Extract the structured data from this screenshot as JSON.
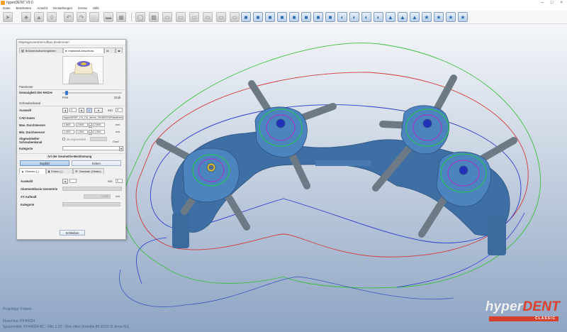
{
  "window": {
    "title": "hyperDENT V9.0"
  },
  "menu": [
    "Datei",
    "Bearbeiten",
    "Ansicht",
    "Einstellungen",
    "Extras",
    "Hilfe"
  ],
  "panel": {
    "title": "Objektgeometrie/Aufbau bestimmen",
    "tabs": [
      "Brückenzwischenglieder",
      "Implantat-Anschluss",
      "Id"
    ],
    "params_header": "Parameter",
    "mesh_accuracy_label": "Genauigkeit des Netzes",
    "slider_min": "Fein",
    "slider_max": "Grob",
    "slider_value": 0.05,
    "screw_header": "Schraubenkanal",
    "selection_label": "Auswahl",
    "selection_count": "4",
    "selection_of": "von",
    "selection_total": "4",
    "cad_label": "CAD-Daten",
    "cad_value": "hyperDENT_C4_CA_direct_20180223/Fräsdirect",
    "max_dia_label": "Max. Durchmesser",
    "max_dia_values": [
      "2.600",
      "2.600",
      "2.600"
    ],
    "min_dia_label": "Min. Durchmesser",
    "min_dia_values": [
      "1.300",
      "1.300",
      "1.300"
    ],
    "unit_mm": "mm",
    "angled_label_1": "Abgewinkelter",
    "angled_label_2": "Schraubenkanal",
    "angled_check": "ist angewinkelt",
    "angle_unit": "Grad",
    "category_label": "Kategorie",
    "geometry_header": "Art der Geometrie-Bestimmung",
    "explicit_label": "Explizit",
    "edges_label": "Ecken",
    "subtabs": [
      "Ebenen (-)",
      "Ecken (-)",
      "Gewinde (Hinten)"
    ],
    "sub_selection_label": "Auswahl",
    "sub_selection_of": "von",
    "sub_selection_total": "0",
    "sub_geometry_label": "Abutmentbasis Geometrie",
    "sub_height_label": "XY-Aufmaß",
    "sub_height_value": "0.000",
    "sub_category_label": "Kategorie",
    "close_label": "Schließen"
  },
  "status": {
    "project": "Projekttyp: Fräsen",
    "machine": "Maschine: PFH4024",
    "clamp": "Spannmittel: PFH4024-BC - FAL 1.22 - Disc offen (Fräsfile 89-ZrO2-11 6mm-N1)"
  },
  "logo": {
    "brand_a": "hyper",
    "brand_b": "DENT",
    "sub": "CLASSIC"
  },
  "toolbar": {
    "icons": [
      "cursor-icon",
      "teeth-icon",
      "import-icon",
      "bridge-icon",
      "undo-icon",
      "redo-icon",
      "measure-icon",
      "cut-icon",
      "grid-icon",
      "disc-icon",
      "save-icon",
      "tool-a-icon",
      "tool-b-icon",
      "tool-c-icon",
      "tool-d-icon",
      "tool-e-icon",
      "tool-f-icon",
      "tool-g-icon",
      "tool-h-icon",
      "tool-i-icon",
      "tool-j-icon",
      "view-front-icon",
      "view-back-icon",
      "view-left-icon",
      "view-right-icon",
      "view-top-icon",
      "view-bottom-icon",
      "view-iso-icon",
      "view-fit-icon",
      "shade-a-icon",
      "shade-b-icon",
      "shade-c-icon",
      "shade-d-icon",
      "calc-a-icon",
      "calc-b-icon",
      "calc-c-icon"
    ]
  },
  "colors": {
    "accent": "#2b6cb0",
    "brand_red": "#e0412b",
    "model": "#3e6fa4",
    "stud": "#6d7a86"
  }
}
